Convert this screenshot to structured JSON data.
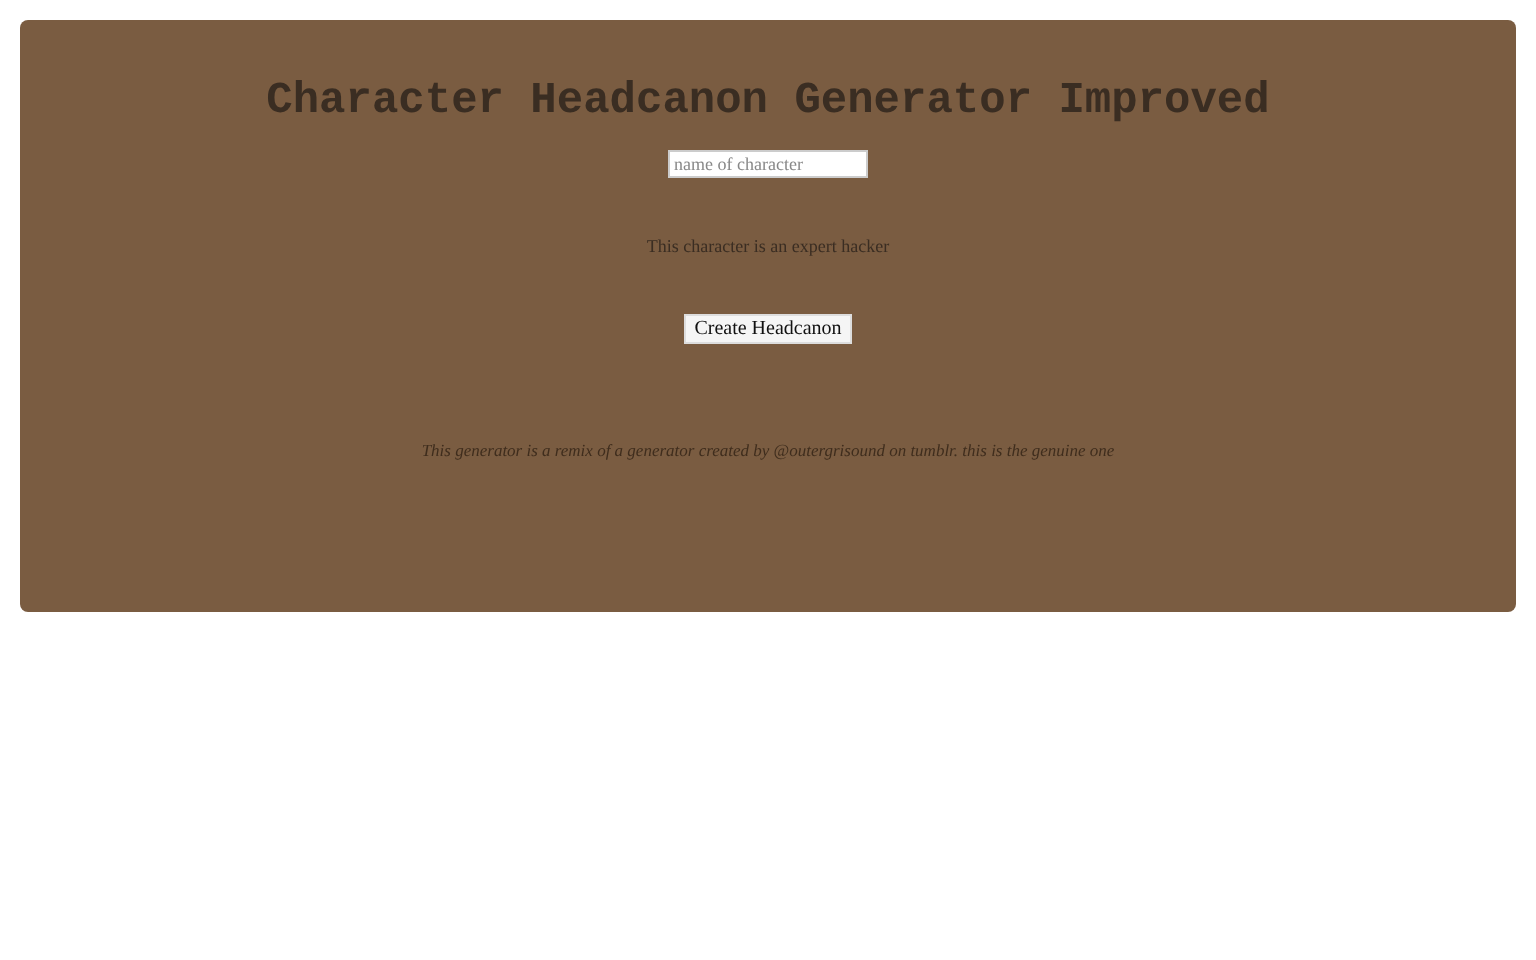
{
  "title": "Character Headcanon Generator Improved",
  "name_field": {
    "placeholder": "name of character"
  },
  "result": "This character is an expert hacker",
  "button": "Create Headcanon",
  "footer": "This generator is a remix of a generator created by @outergrisound on tumblr. this is the genuine one"
}
